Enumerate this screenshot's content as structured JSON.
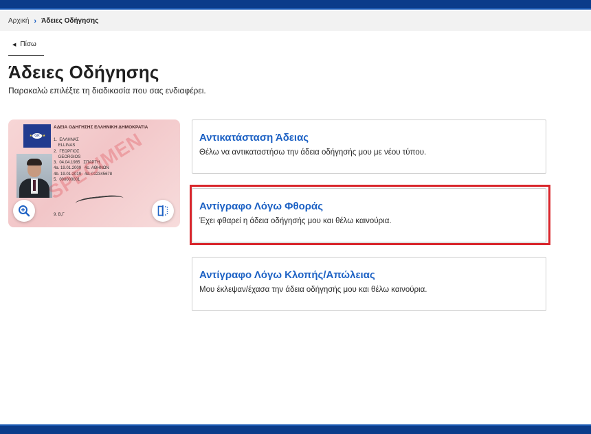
{
  "breadcrumb": {
    "home": "Αρχική",
    "current": "Άδειες Οδήγησης"
  },
  "back_label": "Πίσω",
  "page": {
    "title": "Άδειες Οδήγησης",
    "subtitle": "Παρακαλώ επιλέξτε τη διαδικασία που σας ενδιαφέρει."
  },
  "license_card": {
    "header": "ΑΔΕΙΑ ΟΔΗΓΗΣΗΣ  ΕΛΛΗΝΙΚΗ ΔΗΜΟΚΡΑΤΙΑ",
    "country_code": "GR",
    "fields": "1.  ΕΛΛΗΝΑΣ\n    ELLINAS\n2.  ΓΕΩΡΓΙΟΣ\n    GEORGIOS\n3.  04.04.1985   ΣΠΑΡΤΗ\n4a. 19.01.2009   4c. ΑΘΗΝΩΝ\n4b. 19.01.2019   4d. 012345678\n5.  000000001",
    "field9": "9.  B,Γ",
    "watermark": "SPECIMEN",
    "zoom_icon": "zoom-in-icon",
    "compare_icon": "compare-icon"
  },
  "options": [
    {
      "title": "Αντικατάσταση Άδειας",
      "description": "Θέλω να αντικαταστήσω την άδεια οδήγησής μου με νέου τύπου."
    },
    {
      "title": "Αντίγραφο Λόγω Φθοράς",
      "description": "Έχει φθαρεί η άδεια οδήγησής μου και θέλω καινούρια."
    },
    {
      "title": "Αντίγραφο Λόγω Κλοπής/Απώλειας",
      "description": "Μου έκλεψαν/έχασα την άδεια οδήγησής μου και θέλω καινούρια."
    }
  ],
  "colors": {
    "brand": "#0b3c8a",
    "link": "#1c61c4",
    "highlight": "#d9252b"
  }
}
